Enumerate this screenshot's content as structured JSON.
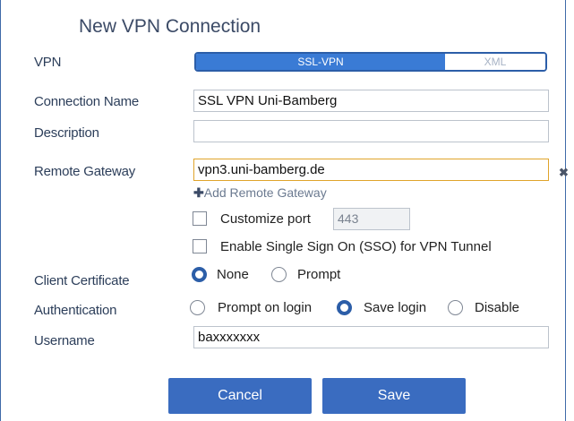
{
  "dialog": {
    "title": "New VPN Connection"
  },
  "vpn": {
    "label": "VPN",
    "options": [
      "SSL-VPN",
      "XML"
    ],
    "selected": "SSL-VPN"
  },
  "connection_name": {
    "label": "Connection Name",
    "value": "SSL VPN Uni-Bamberg"
  },
  "description": {
    "label": "Description",
    "value": ""
  },
  "remote_gateway": {
    "label": "Remote Gateway",
    "value": "vpn3.uni-bamberg.de",
    "add_label": "Add Remote Gateway",
    "add_icon": "plus-icon",
    "clear_icon": "close-icon"
  },
  "customize_port": {
    "label": "Customize port",
    "checked": false,
    "port_value": "443"
  },
  "sso": {
    "label": "Enable Single Sign On (SSO) for VPN Tunnel",
    "checked": false
  },
  "client_certificate": {
    "label": "Client Certificate",
    "options": [
      "None",
      "Prompt"
    ],
    "selected": "None"
  },
  "authentication": {
    "label": "Authentication",
    "options": [
      "Prompt on login",
      "Save login",
      "Disable"
    ],
    "selected": "Save login"
  },
  "username": {
    "label": "Username",
    "value": "baxxxxxxx"
  },
  "buttons": {
    "cancel": "Cancel",
    "save": "Save"
  },
  "colors": {
    "accent": "#3a7bd5",
    "button": "#3a6cc0",
    "focus_border": "#e0a42b"
  }
}
